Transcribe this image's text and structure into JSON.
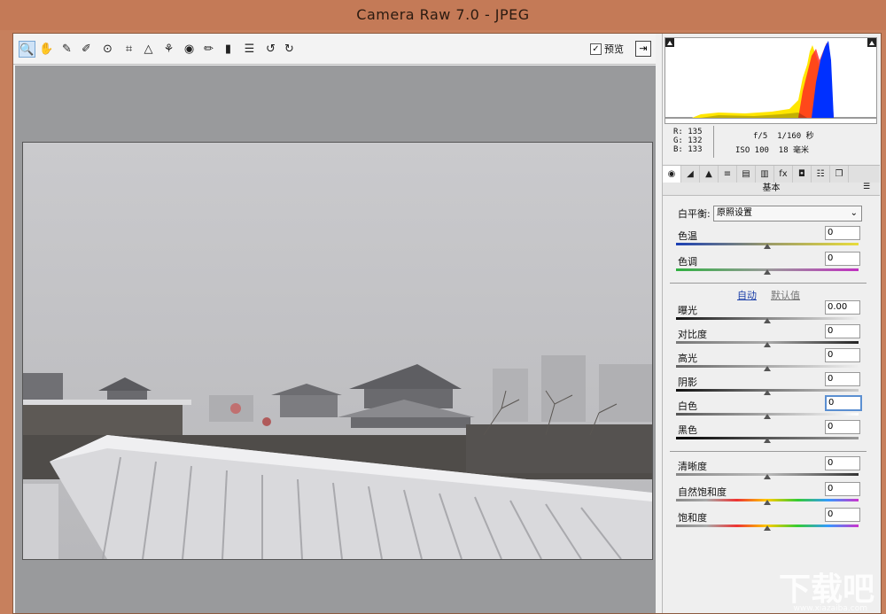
{
  "window": {
    "title": "Camera Raw 7.0 -  JPEG"
  },
  "toolbar": {
    "tools": [
      {
        "name": "zoom-tool",
        "glyph": "🔍"
      },
      {
        "name": "hand-tool",
        "glyph": "✋"
      },
      {
        "name": "white-balance-tool",
        "glyph": "✎"
      },
      {
        "name": "color-sampler-tool",
        "glyph": "✐"
      },
      {
        "name": "targeted-adjustment-tool",
        "glyph": "⊙"
      },
      {
        "name": "crop-tool",
        "glyph": "⌗"
      },
      {
        "name": "straighten-tool",
        "glyph": "△"
      },
      {
        "name": "spot-removal-tool",
        "glyph": "⚘"
      },
      {
        "name": "red-eye-tool",
        "glyph": "◉"
      },
      {
        "name": "adjustment-brush-tool",
        "glyph": "✏"
      },
      {
        "name": "graduated-filter-tool",
        "glyph": "▮"
      },
      {
        "name": "preferences-tool",
        "glyph": "☰"
      },
      {
        "name": "rotate-left-tool",
        "glyph": "↺"
      },
      {
        "name": "rotate-right-tool",
        "glyph": "↻"
      }
    ],
    "preview_label": "预览",
    "preview_checked": "✓",
    "exit_glyph": "⇥"
  },
  "info": {
    "r_label": "R:",
    "r_value": "135",
    "g_label": "G:",
    "g_value": "132",
    "b_label": "B:",
    "b_value": "133",
    "aperture": "f/5",
    "shutter": "1/160 秒",
    "iso": "ISO 100",
    "focal": "18 毫米"
  },
  "tabs": [
    {
      "name": "basic",
      "glyph": "◉"
    },
    {
      "name": "tone-curve",
      "glyph": "◢"
    },
    {
      "name": "detail",
      "glyph": "▲"
    },
    {
      "name": "hsl",
      "glyph": "≡"
    },
    {
      "name": "split-toning",
      "glyph": "▤"
    },
    {
      "name": "lens-corrections",
      "glyph": "▥"
    },
    {
      "name": "effects",
      "glyph": "fx"
    },
    {
      "name": "camera-calibration",
      "glyph": "◘"
    },
    {
      "name": "presets",
      "glyph": "☷"
    },
    {
      "name": "snapshots",
      "glyph": "❐"
    }
  ],
  "panel": {
    "title": "基本",
    "white_balance_label": "白平衡:",
    "white_balance_value": "原照设置",
    "auto_link": "自动",
    "default_link": "默认值",
    "sliders": {
      "temperature": {
        "label": "色温",
        "value": "0"
      },
      "tint": {
        "label": "色调",
        "value": "0"
      },
      "exposure": {
        "label": "曝光",
        "value": "0.00"
      },
      "contrast": {
        "label": "对比度",
        "value": "0"
      },
      "highlights": {
        "label": "高光",
        "value": "0"
      },
      "shadows": {
        "label": "阴影",
        "value": "0"
      },
      "whites": {
        "label": "白色",
        "value": "0"
      },
      "blacks": {
        "label": "黑色",
        "value": "0"
      },
      "clarity": {
        "label": "清晰度",
        "value": "0"
      },
      "vibrance": {
        "label": "自然饱和度",
        "value": "0"
      },
      "saturation": {
        "label": "饱和度",
        "value": "0"
      }
    }
  },
  "colors": {
    "accent": "#5b8fd1",
    "sky": "#c9c9cc",
    "snow": "#e4e4e6"
  },
  "watermark": {
    "text": "下载吧",
    "url_text": "www.xiazaiba.com"
  }
}
